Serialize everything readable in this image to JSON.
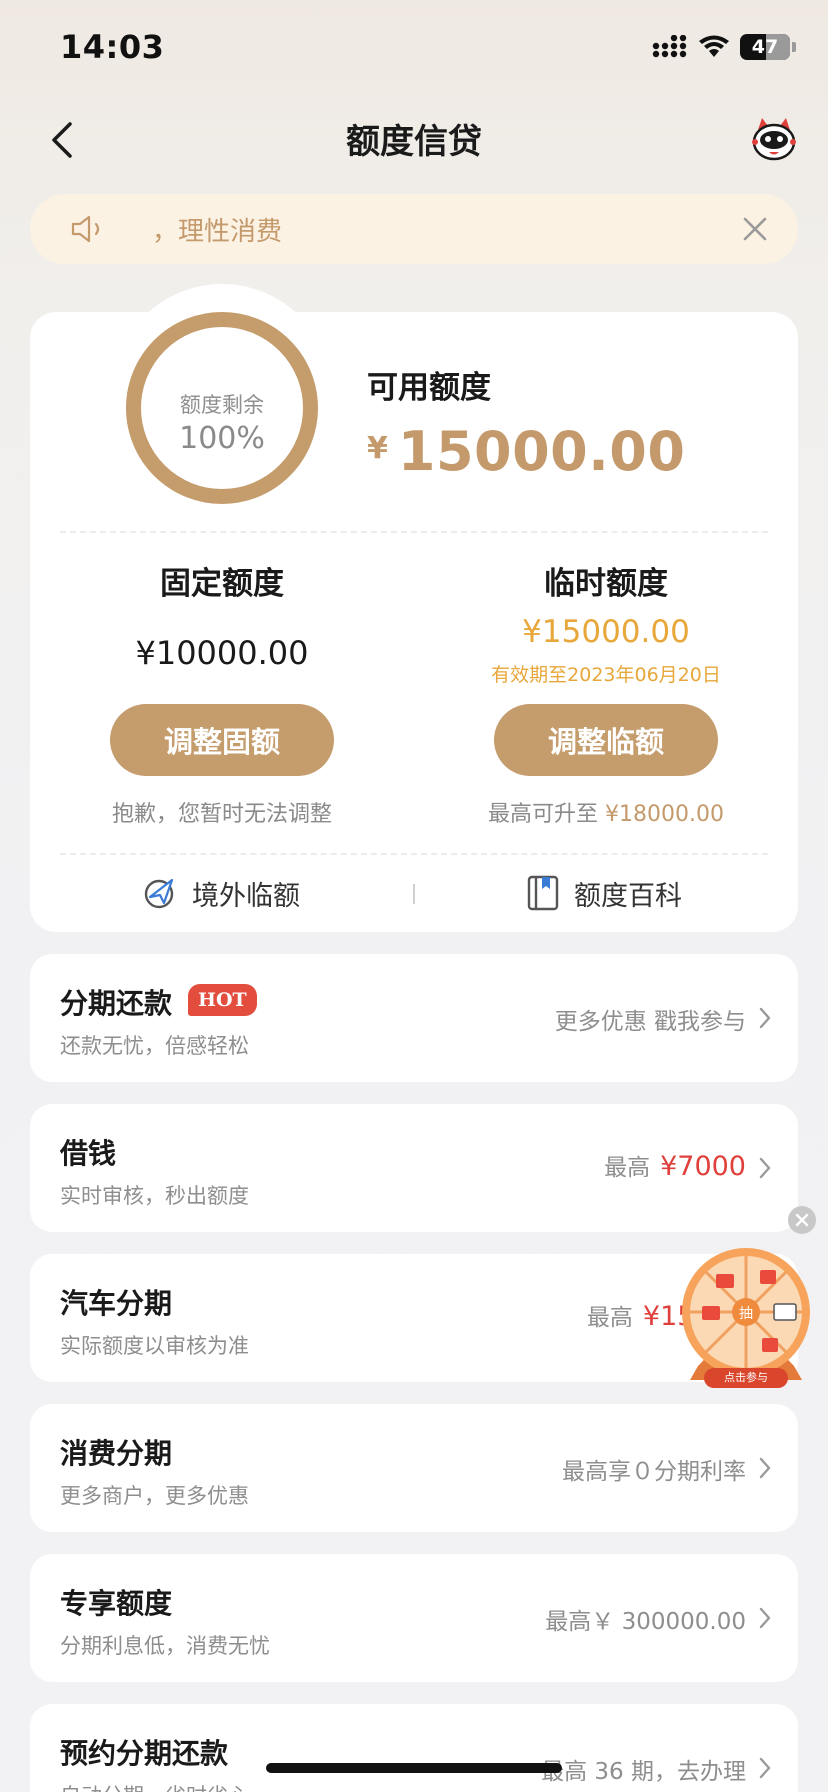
{
  "status_bar": {
    "time": "14:03",
    "battery": "47"
  },
  "nav": {
    "title": "额度信贷"
  },
  "notice": {
    "text": "，理性消费"
  },
  "summary": {
    "ring_label": "额度剩余",
    "ring_percent": "100%",
    "ring_fraction": 1.0,
    "available_label": "可用额度",
    "available_currency": "¥",
    "available_amount": "15000.00"
  },
  "fixed": {
    "title": "固定额度",
    "amount": "¥10000.00",
    "button": "调整固额",
    "note": "抱歉，您暂时无法调整"
  },
  "temporary": {
    "title": "临时额度",
    "amount": "¥15000.00",
    "expiry": "有效期至2023年06月20日",
    "button": "调整临额",
    "note_prefix": "最高可升至",
    "note_amount": "¥18000.00"
  },
  "links": {
    "overseas": "境外临额",
    "encyclopedia": "额度百科"
  },
  "list": [
    {
      "title": "分期还款",
      "badge": "HOT",
      "subtitle": "还款无忧，倍感轻松",
      "right_text": "更多优惠 戳我参与",
      "right_highlight": ""
    },
    {
      "title": "借钱",
      "badge": "",
      "subtitle": "实时审核，秒出额度",
      "right_text": "最高",
      "right_highlight": "¥7000"
    },
    {
      "title": "汽车分期",
      "badge": "",
      "subtitle": "实际额度以审核为准",
      "right_text": "最高",
      "right_highlight": "¥15000"
    },
    {
      "title": "消费分期",
      "badge": "",
      "subtitle": "更多商户，更多优惠",
      "right_text": "最高享０分期利率",
      "right_highlight": ""
    },
    {
      "title": "专享额度",
      "badge": "",
      "subtitle": "分期利息低，消费无忧",
      "right_text": "最高￥ 300000.00",
      "right_highlight": ""
    },
    {
      "title": "预约分期还款",
      "badge": "",
      "subtitle": "自动分期，省时省心",
      "right_text": "最高 36 期，去办理",
      "right_highlight": ""
    }
  ],
  "wheel": {
    "center": "抽",
    "caption": "点击参与"
  },
  "colors": {
    "accent": "#c59c6c",
    "temp": "#e8a73a",
    "red": "#e0403c",
    "notice_bg": "#fcf2e4"
  }
}
